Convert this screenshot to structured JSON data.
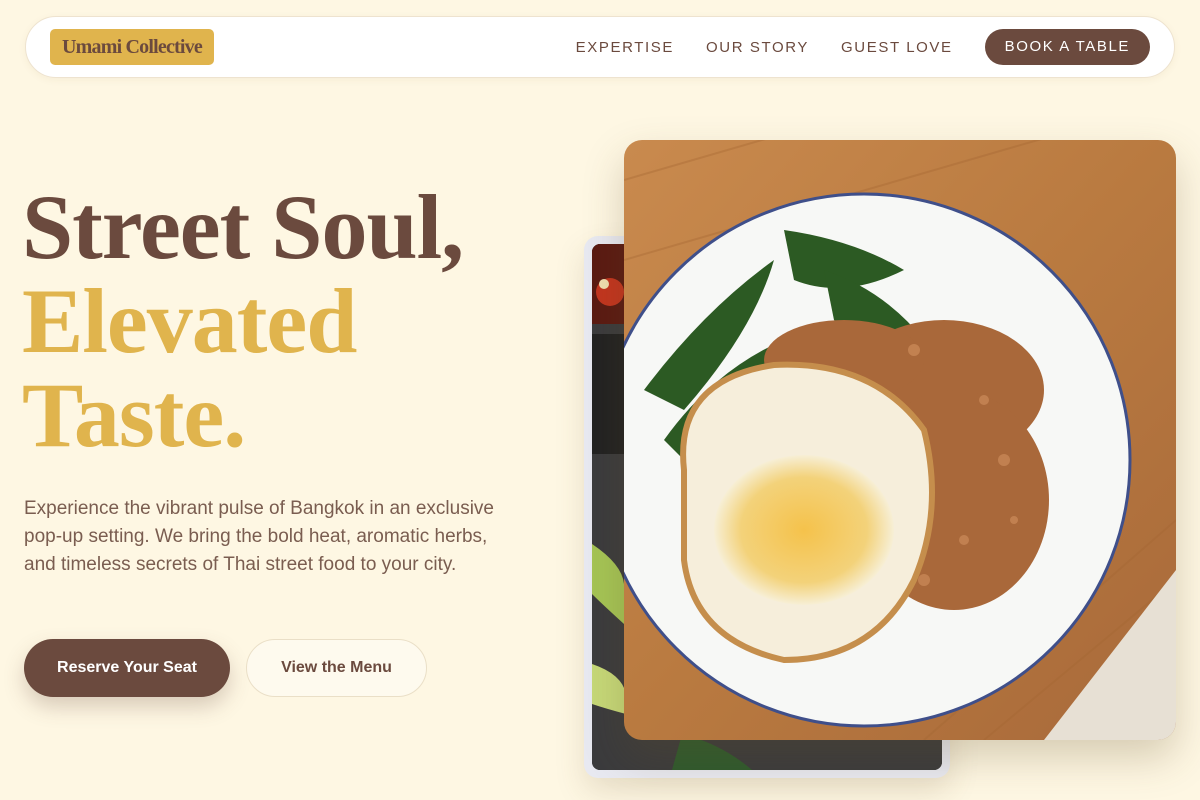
{
  "nav": {
    "logo": "Umami Collective",
    "links": [
      "EXPERTISE",
      "OUR STORY",
      "GUEST LOVE"
    ],
    "cta": "BOOK A TABLE"
  },
  "hero": {
    "headline_line1": "Street Soul,",
    "headline_line2": "Elevated",
    "headline_line3": "Taste.",
    "description": "Experience the vibrant pulse of Bangkok in an exclusive pop-up setting. We bring the bold heat, aromatic herbs, and timeless secrets of Thai street food to your city.",
    "primary_button": "Reserve Your Seat",
    "secondary_button": "View the Menu"
  },
  "images": {
    "back": "thai-dishes-photo",
    "main": "basil-stir-fry-with-fried-egg-photo"
  },
  "colors": {
    "background": "#fef7e3",
    "brown": "#6b4a3e",
    "gold": "#e0b44d"
  }
}
